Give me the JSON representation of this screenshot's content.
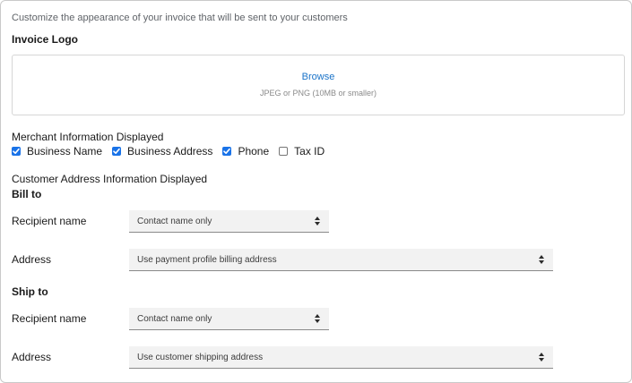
{
  "intro_text": "Customize the appearance of your invoice that will be sent to your customers",
  "logo": {
    "heading": "Invoice Logo",
    "browse_label": "Browse",
    "hint": "JPEG or PNG (10MB or smaller)"
  },
  "merchant": {
    "heading": "Merchant Information Displayed",
    "options": [
      {
        "label": "Business Name",
        "checked": true
      },
      {
        "label": "Business Address",
        "checked": true
      },
      {
        "label": "Phone",
        "checked": true
      },
      {
        "label": "Tax ID",
        "checked": false
      }
    ]
  },
  "customer": {
    "heading": "Customer Address Information Displayed",
    "bill_to": {
      "heading": "Bill to",
      "recipient_label": "Recipient name",
      "recipient_value": "Contact name only",
      "address_label": "Address",
      "address_value": "Use payment profile billing address"
    },
    "ship_to": {
      "heading": "Ship to",
      "recipient_label": "Recipient name",
      "recipient_value": "Contact name only",
      "address_label": "Address",
      "address_value": "Use customer shipping address"
    }
  },
  "colors": {
    "accent": "#1a73e8",
    "link": "#1a73c8",
    "select_bg": "#f2f2f2"
  }
}
